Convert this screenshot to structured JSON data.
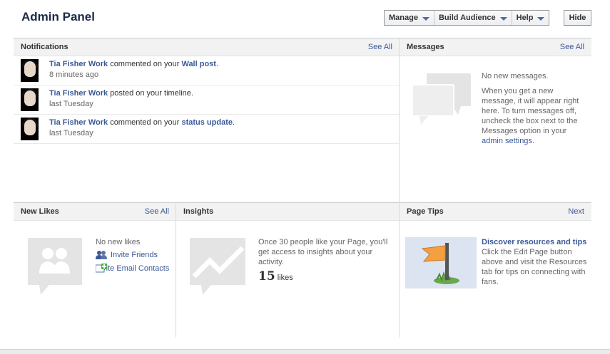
{
  "header": {
    "title": "Admin Panel",
    "buttons": {
      "manage": "Manage",
      "build_audience": "Build Audience",
      "help": "Help",
      "hide": "Hide"
    }
  },
  "notifications": {
    "title": "Notifications",
    "see_all": "See All",
    "items": [
      {
        "actor": "Tia Fisher Work",
        "action": "commented on your",
        "object": "Wall post",
        "suffix": ".",
        "time": "8 minutes ago"
      },
      {
        "actor": "Tia Fisher Work",
        "action": "posted on your timeline.",
        "object": "",
        "suffix": "",
        "time": "last Tuesday"
      },
      {
        "actor": "Tia Fisher Work",
        "action": "commented on your",
        "object": "status update",
        "suffix": ".",
        "time": "last Tuesday"
      }
    ]
  },
  "messages": {
    "title": "Messages",
    "see_all": "See All",
    "empty": "No new messages.",
    "body": "When you get a new message, it will appear right here. To turn messages off, uncheck the box next to the Messages option in your",
    "link": "admin settings",
    "link_suffix": "."
  },
  "new_likes": {
    "title": "New Likes",
    "see_all": "See All",
    "empty": "No new likes",
    "invite_friends": "Invite Friends",
    "invite_email": "Invite Email Contacts"
  },
  "insights": {
    "title": "Insights",
    "body": "Once 30 people like your Page, you'll get access to insights about your activity.",
    "count": "15",
    "count_label": "likes"
  },
  "page_tips": {
    "title": "Page Tips",
    "next": "Next",
    "heading": "Discover resources and tips",
    "body": "Click the Edit Page button above and visit the Resources tab for tips on connecting with fans."
  },
  "colors": {
    "link": "#3b5998",
    "header_bg": "#f2f2f2",
    "title": "#1c2a47"
  }
}
